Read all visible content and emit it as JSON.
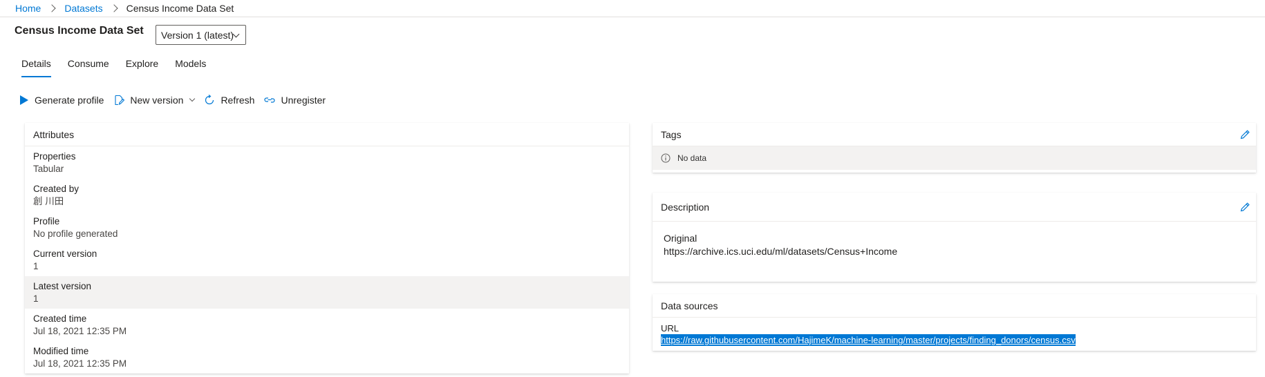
{
  "breadcrumb": {
    "home": "Home",
    "datasets": "Datasets",
    "current": "Census Income Data Set"
  },
  "page": {
    "title": "Census Income Data Set",
    "version_selected": "Version 1 (latest)"
  },
  "tabs": [
    {
      "label": "Details",
      "active": true
    },
    {
      "label": "Consume",
      "active": false
    },
    {
      "label": "Explore",
      "active": false
    },
    {
      "label": "Models",
      "active": false
    }
  ],
  "toolbar": {
    "generate_profile": "Generate profile",
    "new_version": "New version",
    "refresh": "Refresh",
    "unregister": "Unregister"
  },
  "attributes": {
    "title": "Attributes",
    "rows": [
      {
        "label": "Properties",
        "value": "Tabular"
      },
      {
        "label": "Created by",
        "value": "創 川田"
      },
      {
        "label": "Profile",
        "value": "No profile generated"
      },
      {
        "label": "Current version",
        "value": "1"
      },
      {
        "label": "Latest version",
        "value": "1"
      },
      {
        "label": "Created time",
        "value": "Jul 18, 2021 12:35 PM"
      },
      {
        "label": "Modified time",
        "value": "Jul 18, 2021 12:35 PM"
      }
    ]
  },
  "tags": {
    "title": "Tags",
    "empty_text": "No data"
  },
  "description": {
    "title": "Description",
    "line1": "Original",
    "line2": "https://archive.ics.uci.edu/ml/datasets/Census+Income"
  },
  "data_sources": {
    "title": "Data sources",
    "url_label": "URL",
    "url": "https://raw.githubusercontent.com/HajimeK/machine-learning/master/projects/finding_donors/census.csv"
  },
  "colors": {
    "accent": "#0078d4",
    "selection_bg": "#0078d4",
    "highlight_row": "#f3f2f1"
  },
  "icons": [
    "chevron-right-icon",
    "chevron-down-icon",
    "play-icon",
    "edit-document-icon",
    "refresh-icon",
    "unlink-icon",
    "edit-pencil-icon",
    "info-icon"
  ]
}
